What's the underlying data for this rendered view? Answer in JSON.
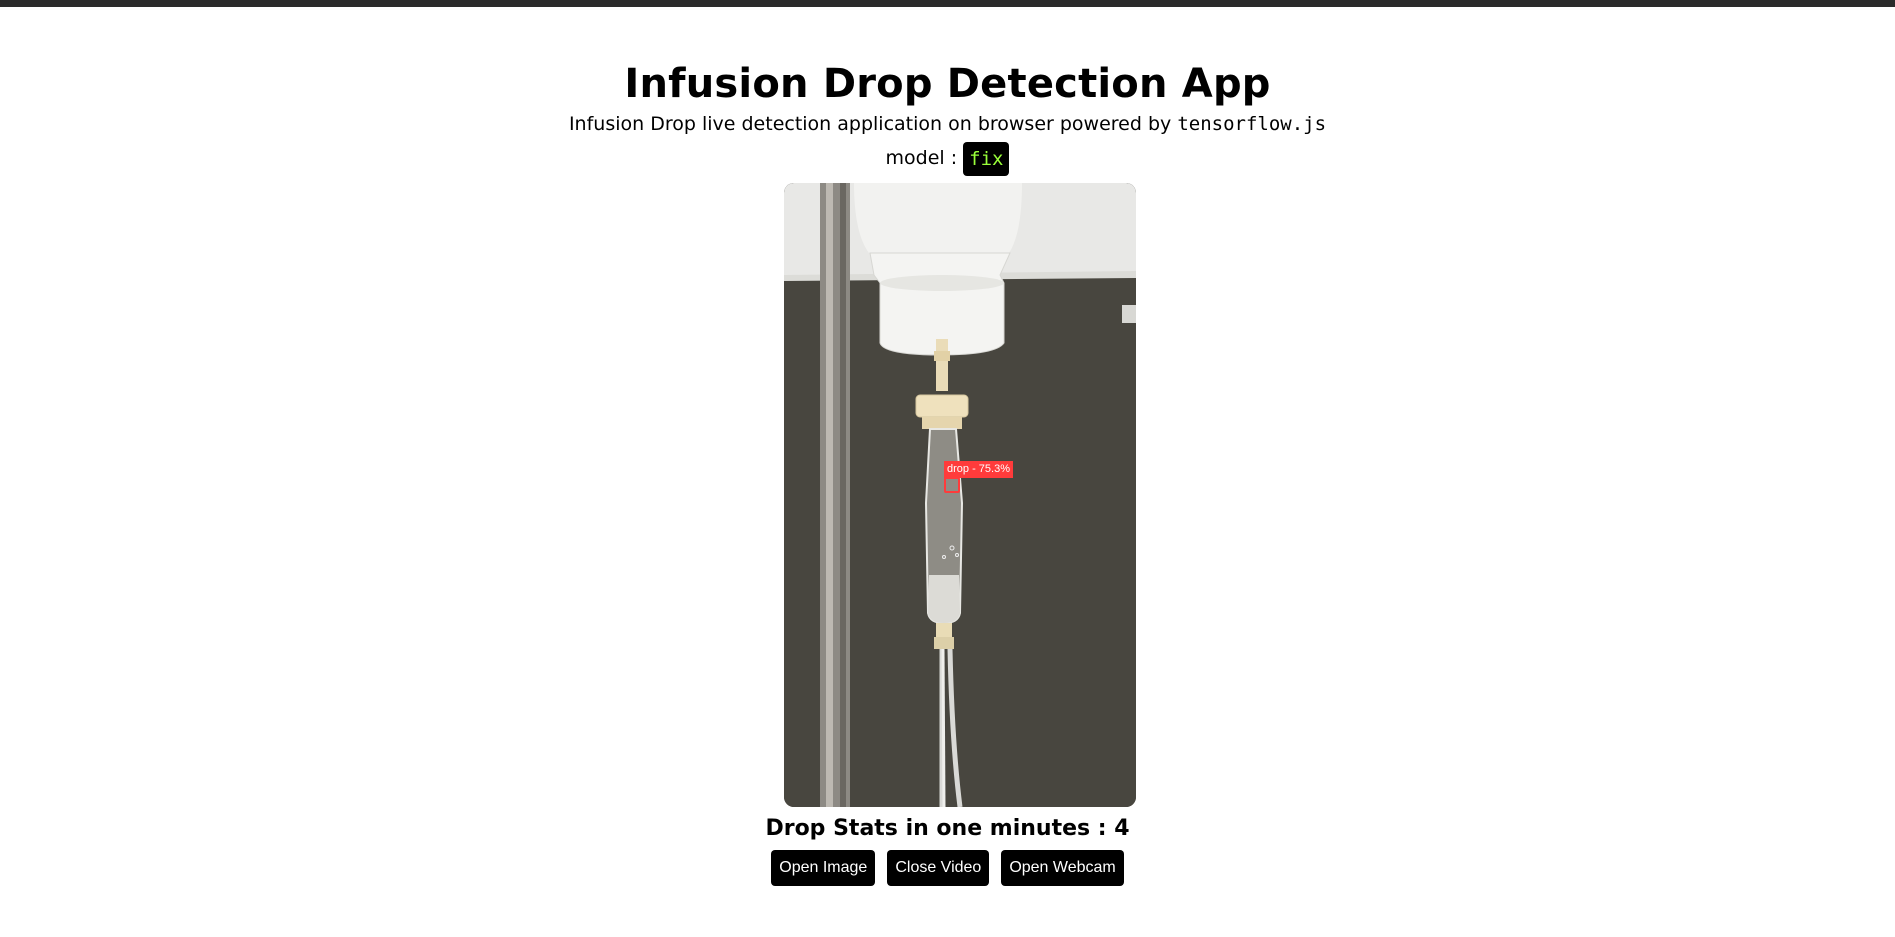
{
  "header": {
    "title": "Infusion Drop Detection App",
    "subtitle_text": "Infusion Drop live detection application on browser powered by ",
    "subtitle_code": "tensorflow.js",
    "model_label": "model : ",
    "model_value": "fix"
  },
  "viewer": {
    "detection_label": "drop - 75.3%",
    "detection_color": "#ff3b3b"
  },
  "stats": {
    "label": "Drop Stats in one minutes : ",
    "value": "4"
  },
  "buttons": {
    "open_image": "Open Image",
    "close_video": "Close Video",
    "open_webcam": "Open Webcam"
  },
  "colors": {
    "top_bar": "#2b2b2b",
    "button_bg": "#000000",
    "model_badge_text": "#9aff3a"
  }
}
